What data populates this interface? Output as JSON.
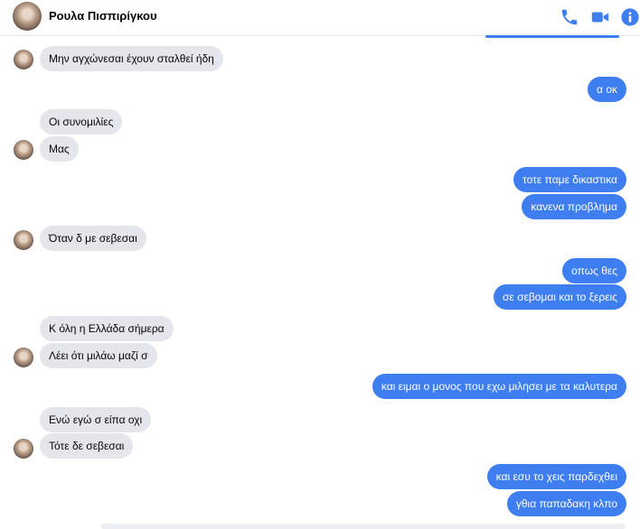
{
  "header": {
    "contact_name": "Ρουλα Πισπιρίγκου",
    "icons": [
      "phone-icon",
      "video-camera-icon",
      "info-icon"
    ],
    "accent_color": "#3f7ef0"
  },
  "messages": [
    {
      "dir": "in",
      "text": "Μην αγχώνεσαι έχουν σταλθεί ήδη"
    },
    {
      "dir": "out",
      "text": "α οκ"
    },
    {
      "dir": "in",
      "text": "Οι συνομιλίες"
    },
    {
      "dir": "in",
      "text": "Μας"
    },
    {
      "dir": "out",
      "text": "τοτε παμε δικαστικα"
    },
    {
      "dir": "out",
      "text": "κανενα προβλημα"
    },
    {
      "dir": "in",
      "text": "Όταν δ με σεβεσαι"
    },
    {
      "dir": "out",
      "text": "οπως θες"
    },
    {
      "dir": "out",
      "text": "σε σεβομαι και το ξερεις"
    },
    {
      "dir": "in",
      "text": "Κ όλη η Ελλάδα σήμερα"
    },
    {
      "dir": "in",
      "text": "Λέει ότι μιλάω μαζί σ"
    },
    {
      "dir": "out",
      "text": "και ειμαι ο μονος που εχω μιλησει με τα καλυτερα"
    },
    {
      "dir": "in",
      "text": "Ενώ εγώ σ είπα οχι"
    },
    {
      "dir": "in",
      "text": "Τότε δε σεβεσαι"
    },
    {
      "dir": "out",
      "text": "και εσυ το χεις παρδεχθει"
    },
    {
      "dir": "out",
      "text": "γθια παπαδακη κλπο"
    }
  ]
}
